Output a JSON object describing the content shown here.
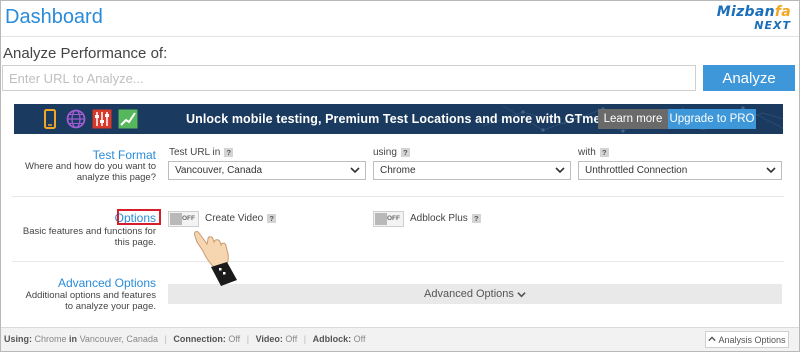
{
  "header": {
    "title": "Dashboard",
    "brand_main": "Mizban",
    "brand_accent": "fa",
    "brand_sub": "NEXT"
  },
  "analyze": {
    "label": "Analyze Performance of:",
    "url_placeholder": "Enter URL to Analyze...",
    "url_value": "",
    "button_label": "Analyze"
  },
  "banner": {
    "text": "Unlock mobile testing, Premium Test Locations and more with GTmetrix PRO",
    "learn_more": "Learn more",
    "upgrade": "Upgrade to PRO",
    "icons": [
      "mobile-icon",
      "globe-icon",
      "settings-sliders-icon",
      "chart-line-icon"
    ]
  },
  "test_format": {
    "title": "Test Format",
    "description": "Where and how do you want to analyze this page?",
    "fields": [
      {
        "label": "Test URL in",
        "help": "?",
        "value": "Vancouver, Canada"
      },
      {
        "label": "using",
        "help": "?",
        "value": "Chrome"
      },
      {
        "label": "with",
        "help": "?",
        "value": "Unthrottled Connection"
      }
    ]
  },
  "options": {
    "title": "Options",
    "description": "Basic features and functions for this page.",
    "toggles": [
      {
        "state": "OFF",
        "label": "Create Video",
        "help": "?"
      },
      {
        "state": "OFF",
        "label": "Adblock Plus",
        "help": "?"
      }
    ]
  },
  "advanced": {
    "title": "Advanced Options",
    "description": "Additional options and features to analyze your page.",
    "bar_label": "Advanced Options"
  },
  "footer": {
    "using_label": "Using:",
    "browser": "Chrome",
    "in_label": "in",
    "location": "Vancouver, Canada",
    "connection_label": "Connection:",
    "connection": "Off",
    "video_label": "Video:",
    "video": "Off",
    "adblock_label": "Adblock:",
    "adblock": "Off",
    "button_label": "Analysis Options"
  },
  "colors": {
    "accent": "#3d97d8",
    "banner_bg": "#1b3a5f",
    "highlight_box": "#d81e2b"
  }
}
